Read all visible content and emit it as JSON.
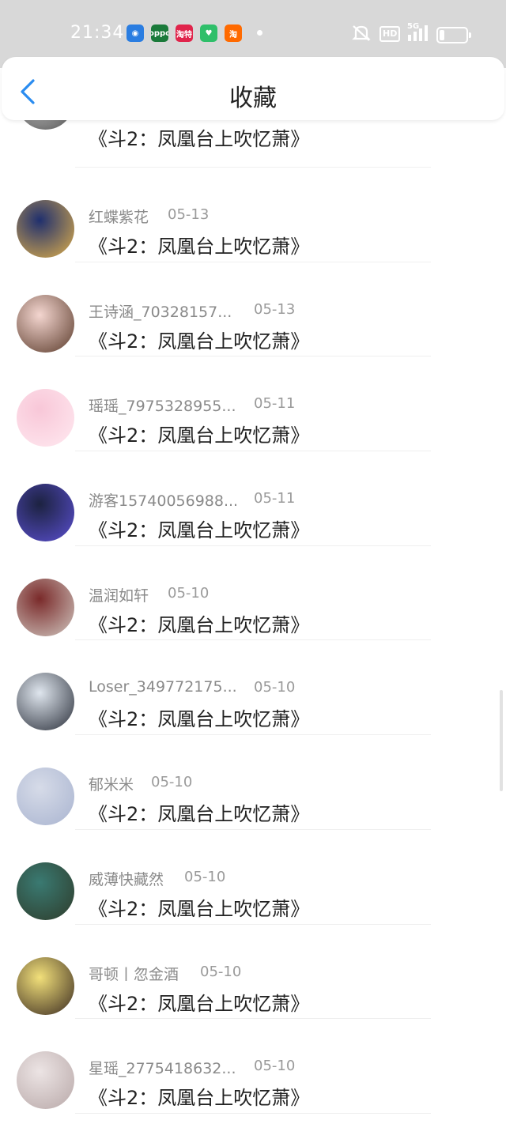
{
  "status_bar": {
    "time": "21:34",
    "notification_icons": [
      {
        "name": "browser-app-icon",
        "color": "#2a7de1",
        "label": "◉"
      },
      {
        "name": "oppo-app-icon",
        "color": "#1a7a3a",
        "label": "oppo"
      },
      {
        "name": "taote-app-icon",
        "color": "#e0244b",
        "label": "淘特"
      },
      {
        "name": "green-app-icon",
        "color": "#2fbf6a",
        "label": "♥"
      },
      {
        "name": "taobao-app-icon",
        "color": "#ff6a00",
        "label": "淘"
      }
    ],
    "hd_label": "HD",
    "network_label": "5G"
  },
  "header": {
    "title": "收藏",
    "back_icon": "chevron-left-icon",
    "accent_color": "#2a8cf0"
  },
  "items": [
    {
      "name": "",
      "date": "",
      "book": "《斗2：凤凰台上吹忆萧》",
      "avatar_colors": [
        "#e8e8e8",
        "#4a4a4a"
      ]
    },
    {
      "name": "红蝶紫花",
      "date": "05-13",
      "book": "《斗2：凤凰台上吹忆萧》",
      "avatar_colors": [
        "#1f2f6e",
        "#e0b04a"
      ]
    },
    {
      "name": "王诗涵_70328157...",
      "date": "05-13",
      "book": "《斗2：凤凰台上吹忆萧》",
      "avatar_colors": [
        "#f4d6d0",
        "#5a3a2a"
      ]
    },
    {
      "name": "瑶瑶_7975328955...",
      "date": "05-11",
      "book": "《斗2：凤凰台上吹忆萧》",
      "avatar_colors": [
        "#f8c7d8",
        "#ffe9f0"
      ]
    },
    {
      "name": "游客15740056988...",
      "date": "05-11",
      "book": "《斗2：凤凰台上吹忆萧》",
      "avatar_colors": [
        "#1c2240",
        "#5a4fd0"
      ]
    },
    {
      "name": "温润如轩",
      "date": "05-10",
      "book": "《斗2：凤凰台上吹忆萧》",
      "avatar_colors": [
        "#7a2a2a",
        "#d0c7c0"
      ]
    },
    {
      "name": "Loser_349772175...",
      "date": "05-10",
      "book": "《斗2：凤凰台上吹忆萧》",
      "avatar_colors": [
        "#dfe6ee",
        "#2a2f3a"
      ]
    },
    {
      "name": "郁米米",
      "date": "05-10",
      "book": "《斗2：凤凰台上吹忆萧》",
      "avatar_colors": [
        "#d6dbe8",
        "#a9b4d0"
      ]
    },
    {
      "name": "威薄快藏然",
      "date": "05-10",
      "book": "《斗2：凤凰台上吹忆萧》",
      "avatar_colors": [
        "#3a7a72",
        "#2e3b2a"
      ]
    },
    {
      "name": "哥顿丨忽金酒",
      "date": "05-10",
      "book": "《斗2：凤凰台上吹忆萧》",
      "avatar_colors": [
        "#f2e07a",
        "#3a2a20"
      ]
    },
    {
      "name": "星瑶_2775418632...",
      "date": "05-10",
      "book": "《斗2：凤凰台上吹忆萧》",
      "avatar_colors": [
        "#ece4e4",
        "#b8a8a8"
      ]
    }
  ]
}
